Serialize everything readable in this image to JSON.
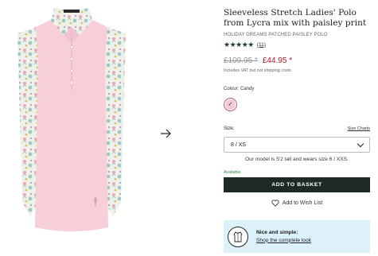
{
  "gallery": {
    "image_icon": "product-photo",
    "next_icon": "arrow-right-icon"
  },
  "product": {
    "title": "Sleeveless Stretch Ladies' Polo from Lycra mix with paisley print",
    "subtitle": "HOLIDAY DREAMS PATCHED PAISLEY POLO",
    "rating": 5,
    "stars": "★★★★★",
    "review_count": "(11)",
    "old_price": "£109.95 *",
    "new_price": "£44.95 *",
    "vat_note": "Includes VAT but not shipping costs"
  },
  "colour": {
    "label": "Colour: Candy",
    "swatch_color": "#f3c9d5",
    "check": "✓"
  },
  "size": {
    "label": "Size:",
    "charts_link": "Size Charts",
    "selected": "8 / XS",
    "model_note": "Our model is 5'2 tall and wears size 6 / XXS.",
    "availability": "Available"
  },
  "actions": {
    "add_to_basket": "ADD TO BASKET",
    "wishlist": "Add to Wish List"
  },
  "complete_look": {
    "heading": "Nice and simple:",
    "link": "Shop the complete look"
  },
  "colors": {
    "accent_dark": "#1d2a24",
    "sale_red": "#b3142a",
    "available_green": "#2f8a4c",
    "info_bg": "#dcf1fa"
  }
}
